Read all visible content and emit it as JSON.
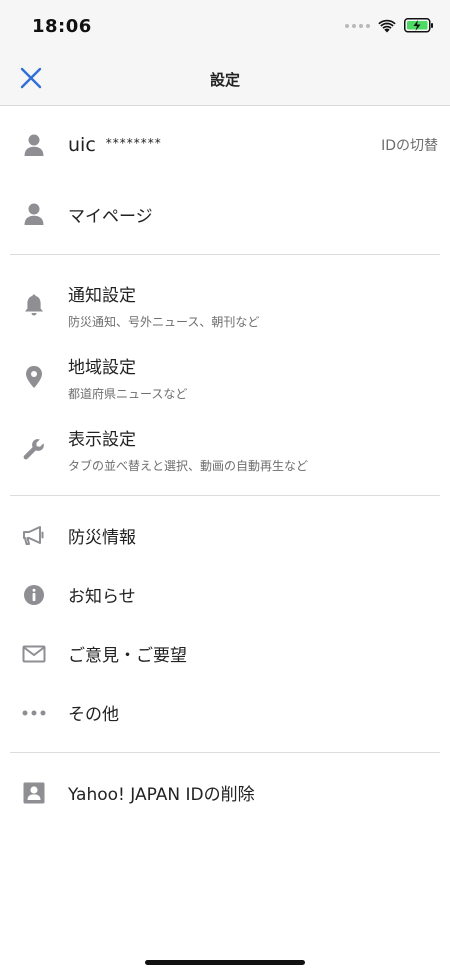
{
  "status_bar": {
    "time": "18:06"
  },
  "header": {
    "title": "設定",
    "close_icon": "close-icon"
  },
  "account": {
    "user_id": "uic",
    "masked": "********",
    "switch_label": "IDの切替",
    "icon": "person-icon"
  },
  "mypage": {
    "label": "マイページ",
    "icon": "person-icon"
  },
  "settings": [
    {
      "label": "通知設定",
      "sub": "防災通知、号外ニュース、朝刊など",
      "icon": "bell-icon"
    },
    {
      "label": "地域設定",
      "sub": "都道府県ニュースなど",
      "icon": "location-pin-icon"
    },
    {
      "label": "表示設定",
      "sub": "タブの並べ替えと選択、動画の自動再生など",
      "icon": "wrench-icon"
    }
  ],
  "info": [
    {
      "label": "防災情報",
      "icon": "megaphone-icon"
    },
    {
      "label": "お知らせ",
      "icon": "info-icon"
    },
    {
      "label": "ご意見・ご要望",
      "icon": "mail-icon"
    },
    {
      "label": "その他",
      "icon": "more-dots-icon"
    }
  ],
  "delete_id": {
    "label": "Yahoo! JAPAN IDの削除",
    "icon": "id-card-icon"
  },
  "colors": {
    "accent": "#2f6fd6",
    "icon_gray": "#8e8e93",
    "divider": "#dcdcdc",
    "header_bg": "#f6f6f6"
  }
}
